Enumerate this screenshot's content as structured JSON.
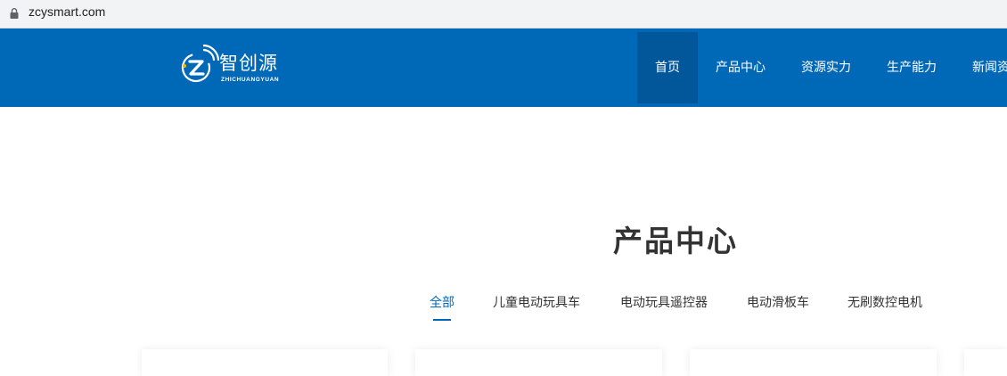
{
  "browser": {
    "url": "zcysmart.com",
    "lock_icon": "lock-icon"
  },
  "header": {
    "logo": {
      "icon": "z-wifi-logo-icon",
      "name_cn": "智创源",
      "name_en": "ZHICHUANGYUAN"
    },
    "nav": [
      {
        "label": "首页",
        "active": true
      },
      {
        "label": "产品中心"
      },
      {
        "label": "资源实力"
      },
      {
        "label": "生产能力"
      },
      {
        "label": "新闻资"
      }
    ],
    "colors": {
      "header_bg": "#0069b7",
      "active_nav_bg": "#02569a"
    }
  },
  "main": {
    "title": "产品中心",
    "tabs": [
      {
        "label": "全部",
        "active": true
      },
      {
        "label": "儿童电动玩具车"
      },
      {
        "label": "电动玩具遥控器"
      },
      {
        "label": "电动滑板车"
      },
      {
        "label": "无刷数控电机"
      }
    ]
  }
}
